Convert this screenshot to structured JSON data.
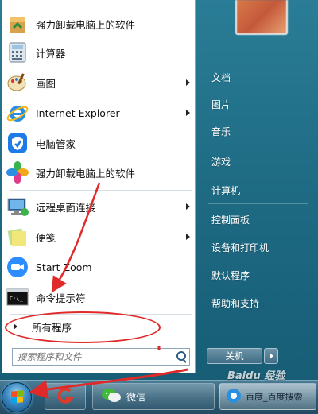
{
  "programs": [
    {
      "label": "强力卸载电脑上的软件",
      "icon": "uninstall-box-icon",
      "submenu": false
    },
    {
      "label": "计算器",
      "icon": "calculator-icon",
      "submenu": false
    },
    {
      "label": "画图",
      "icon": "paint-icon",
      "submenu": true
    },
    {
      "label": "Internet Explorer",
      "icon": "internet-explorer-icon",
      "submenu": true
    },
    {
      "label": "电脑管家",
      "icon": "shield-icon",
      "submenu": false
    },
    {
      "label": "强力卸载电脑上的软件",
      "icon": "pinwheel-icon",
      "submenu": false
    },
    {
      "label": "远程桌面连接",
      "icon": "remote-desktop-icon",
      "submenu": true
    },
    {
      "label": "便笺",
      "icon": "sticky-notes-icon",
      "submenu": true
    },
    {
      "label": "Start Zoom",
      "icon": "zoom-camera-icon",
      "submenu": false
    },
    {
      "label": "命令提示符",
      "icon": "command-prompt-icon",
      "submenu": false
    }
  ],
  "all_programs": "所有程序",
  "search": {
    "placeholder": "搜索程序和文件"
  },
  "right_pane": [
    {
      "label": "文档"
    },
    {
      "label": "图片"
    },
    {
      "label": "音乐"
    },
    {
      "label": "游戏"
    },
    {
      "label": "计算机"
    },
    {
      "label": "控制面板"
    },
    {
      "label": "设备和打印机"
    },
    {
      "label": "默认程序"
    },
    {
      "label": "帮助和支持"
    }
  ],
  "shutdown_label": "关机",
  "taskbar": {
    "wechat_label": "微信",
    "baidu_label": "百度_百度搜索"
  },
  "watermark": "Baidu 经验",
  "annotation_color": "#e02a2a"
}
